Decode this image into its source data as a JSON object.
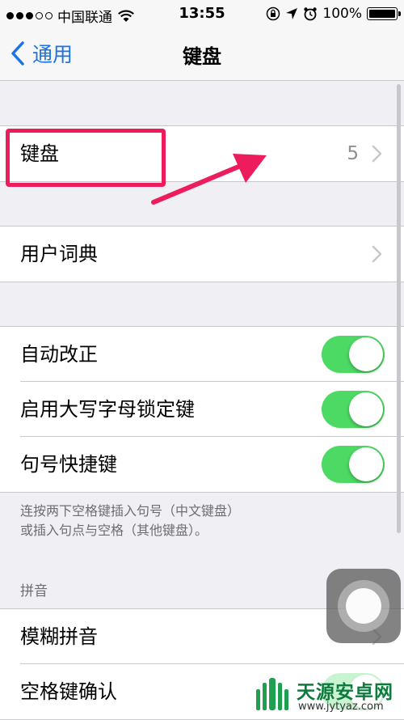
{
  "status_bar": {
    "carrier": "中国联通",
    "time": "13:55",
    "battery": "100%",
    "signal_dots": [
      true,
      true,
      true,
      false,
      false
    ]
  },
  "nav": {
    "back_label": "通用",
    "title": "键盘"
  },
  "keyboards_row": {
    "label": "键盘",
    "value": "5"
  },
  "dictionary_row": {
    "label": "用户词典"
  },
  "toggles": [
    {
      "label": "自动改正",
      "on": true
    },
    {
      "label": "启用大写字母锁定键",
      "on": true
    },
    {
      "label": "句号快捷键",
      "on": true
    }
  ],
  "footnote": {
    "line1": "连按两下空格键插入句号（中文键盘）",
    "line2": "或插入句点与空格（其他键盘）。"
  },
  "pinyin": {
    "header": "拼音",
    "fuzzy_label": "模糊拼音",
    "space_confirm_label": "空格键确认"
  },
  "watermark": {
    "name": "天源安卓网",
    "url": "www.jytyaz.com"
  },
  "colors": {
    "accent_blue": "#1a73e8",
    "toggle_green": "#4cd964",
    "annotation_pink": "#ec1c5d",
    "background": "#efeff4"
  },
  "icons": [
    "wifi-icon",
    "orientation-lock-icon",
    "location-icon",
    "alarm-icon",
    "battery-icon",
    "back-chevron-icon",
    "chevron-right-icon",
    "assistive-touch-icon"
  ]
}
